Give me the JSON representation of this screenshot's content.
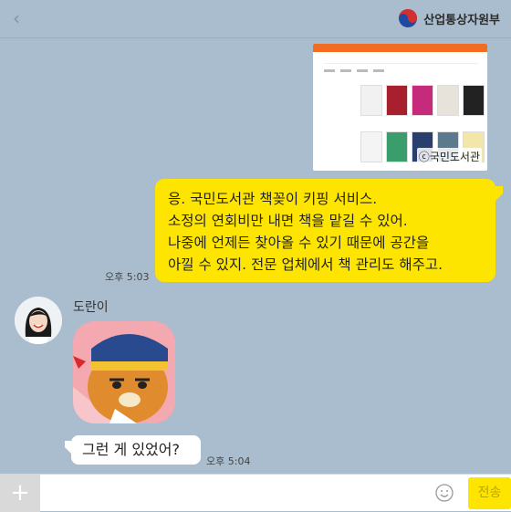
{
  "header": {
    "back_icon": "chevron-left-icon",
    "org_name": "산업통상자원부",
    "logo_icon": "taegeuk-logo"
  },
  "shared_image": {
    "watermark": "ⓒ국민도서관"
  },
  "messages": {
    "mine": {
      "lines": [
        "응. 국민도서관 책꽂이 키핑 서비스.",
        "소정의 연회비만 내면 책을 맡길 수 있어.",
        "나중에 언제든 찾아올 수 있기 때문에 공간을",
        "아낄 수 있지. 전문 업체에서 책 관리도 해주고."
      ],
      "time": "오후 5:03"
    },
    "other": {
      "sender": "도란이",
      "text": "그런 게 있었어?",
      "time": "오후 5:04"
    }
  },
  "composer": {
    "plus": "+",
    "send_label": "전송"
  },
  "colors": {
    "background": "#a9bdce",
    "my_bubble": "#fee500",
    "other_bubble": "#ffffff"
  }
}
